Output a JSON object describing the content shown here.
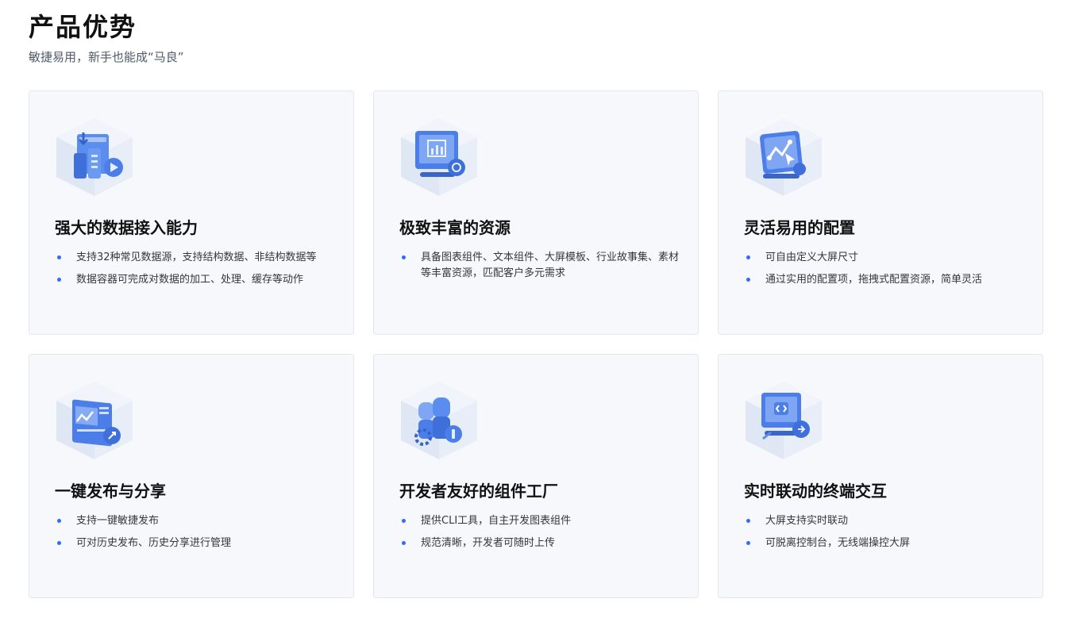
{
  "header": {
    "title": "产品优势",
    "subtitle": "敏捷易用，新手也能成“马良”"
  },
  "colors": {
    "accent": "#2f6bff",
    "card_bg": "#f7f8fb",
    "icon_blue": "#4b7ee8"
  },
  "cards": [
    {
      "icon": "data-source-icon",
      "title": "强大的数据接入能力",
      "points": [
        "支持32种常见数据源，支持结构数据、非结构数据等",
        "数据容器可完成对数据的加工、处理、缓存等动作"
      ]
    },
    {
      "icon": "resource-monitor-icon",
      "title": "极致丰富的资源",
      "points": [
        "具备图表组件、文本组件、大屏模板、行业故事集、素材等丰富资源，匹配客户多元需求"
      ]
    },
    {
      "icon": "config-chart-icon",
      "title": "灵活易用的配置",
      "points": [
        "可自由定义大屏尺寸",
        "通过实用的配置项，拖拽式配置资源，简单灵活"
      ]
    },
    {
      "icon": "publish-share-icon",
      "title": "一键发布与分享",
      "points": [
        "支持一键敏捷发布",
        "可对历史发布、历史分享进行管理"
      ]
    },
    {
      "icon": "developer-component-icon",
      "title": "开发者友好的组件工厂",
      "points": [
        "提供CLI工具，自主开发图表组件",
        "规范清晰，开发者可随时上传"
      ]
    },
    {
      "icon": "terminal-interaction-icon",
      "title": "实时联动的终端交互",
      "points": [
        "大屏支持实时联动",
        "可脱离控制台，无线端操控大屏"
      ]
    }
  ]
}
